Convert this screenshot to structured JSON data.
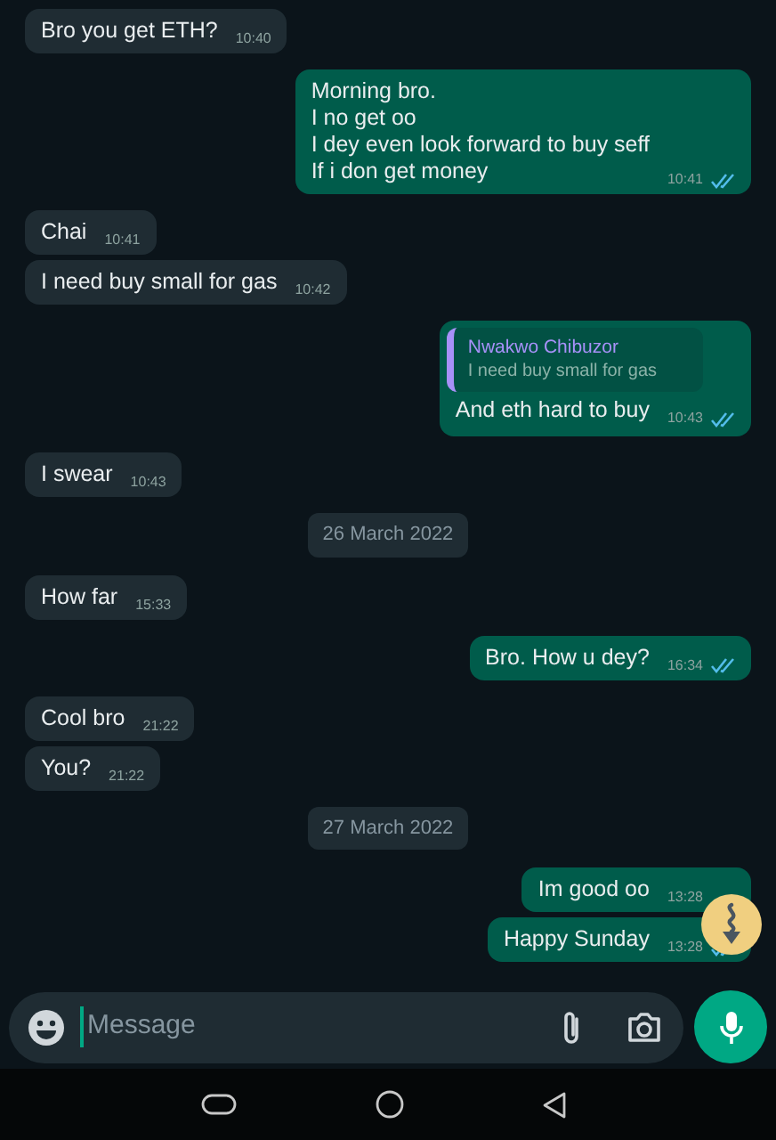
{
  "messages": [
    {
      "kind": "in",
      "lines": [
        "Bro you get ETH?"
      ],
      "time": "10:40"
    },
    {
      "kind": "out",
      "lines": [
        "Morning bro.",
        "I no get oo",
        "I dey even look forward to buy seff",
        "If i don get money"
      ],
      "time": "10:41",
      "read": true
    },
    {
      "kind": "in",
      "lines": [
        "Chai"
      ],
      "time": "10:41"
    },
    {
      "kind": "in",
      "lines": [
        "I need buy small for gas"
      ],
      "time": "10:42"
    },
    {
      "kind": "out",
      "quote": {
        "author": "Nwakwo Chibuzor",
        "text": "I need buy small for gas"
      },
      "lines": [
        "And eth hard to buy"
      ],
      "time": "10:43",
      "read": true
    },
    {
      "kind": "in",
      "lines": [
        "I swear"
      ],
      "time": "10:43"
    },
    {
      "kind": "date",
      "text": "26 March 2022"
    },
    {
      "kind": "in",
      "lines": [
        "How far"
      ],
      "time": "15:33"
    },
    {
      "kind": "out",
      "lines": [
        "Bro. How u dey?"
      ],
      "time": "16:34",
      "read": true
    },
    {
      "kind": "in",
      "lines": [
        "Cool bro"
      ],
      "time": "21:22"
    },
    {
      "kind": "in",
      "lines": [
        "You?"
      ],
      "time": "21:22"
    },
    {
      "kind": "date",
      "text": "27 March 2022"
    },
    {
      "kind": "out",
      "lines": [
        "Im good oo"
      ],
      "time": "13:28"
    },
    {
      "kind": "out",
      "lines": [
        "Happy Sunday"
      ],
      "time": "13:28",
      "read": true
    }
  ],
  "composer": {
    "placeholder": "Message"
  }
}
